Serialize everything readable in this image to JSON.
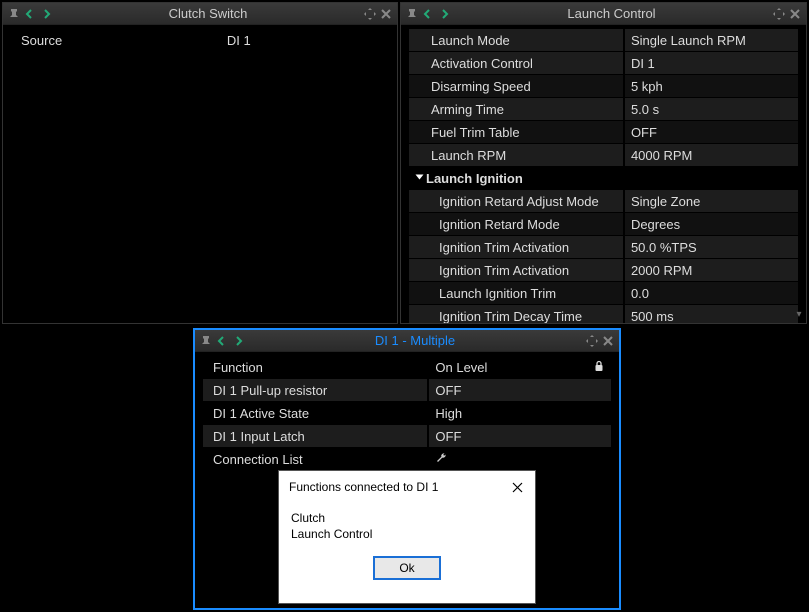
{
  "panels": {
    "clutch": {
      "title": "Clutch Switch",
      "rows": [
        {
          "label": "Source",
          "value": "DI 1"
        }
      ]
    },
    "launch": {
      "title": "Launch Control",
      "rows": [
        {
          "label": "Launch Mode",
          "value": "Single Launch RPM"
        },
        {
          "label": "Activation Control",
          "value": "DI 1"
        },
        {
          "label": "Disarming Speed",
          "value": "5 kph"
        },
        {
          "label": "Arming Time",
          "value": "5.0 s"
        },
        {
          "label": "Fuel Trim Table",
          "value": "OFF"
        },
        {
          "label": "Launch RPM",
          "value": "4000 RPM"
        }
      ],
      "group_label": "Launch Ignition",
      "sub_rows": [
        {
          "label": "Ignition Retard Adjust Mode",
          "value": "Single Zone"
        },
        {
          "label": "Ignition Retard Mode",
          "value": "Degrees"
        },
        {
          "label": "Ignition Trim Activation",
          "value": "50.0 %TPS"
        },
        {
          "label": "Ignition Trim Activation",
          "value": "2000 RPM"
        },
        {
          "label": "Launch Ignition Trim",
          "value": "0.0"
        },
        {
          "label": "Ignition Trim Decay Time",
          "value": "500 ms"
        }
      ]
    },
    "di1": {
      "title": "DI  1 - Multiple",
      "rows": [
        {
          "label": "Function",
          "value": "On Level",
          "locked": true
        },
        {
          "label": "DI 1 Pull-up resistor",
          "value": "OFF"
        },
        {
          "label": "DI 1 Active State",
          "value": "High"
        },
        {
          "label": "DI 1 Input Latch",
          "value": "OFF"
        },
        {
          "label": "Connection List",
          "value": "",
          "wrench": true
        }
      ]
    }
  },
  "dialog": {
    "title": "Functions connected to DI 1",
    "lines": [
      "Clutch",
      "Launch Control"
    ],
    "ok_label": "Ok"
  }
}
